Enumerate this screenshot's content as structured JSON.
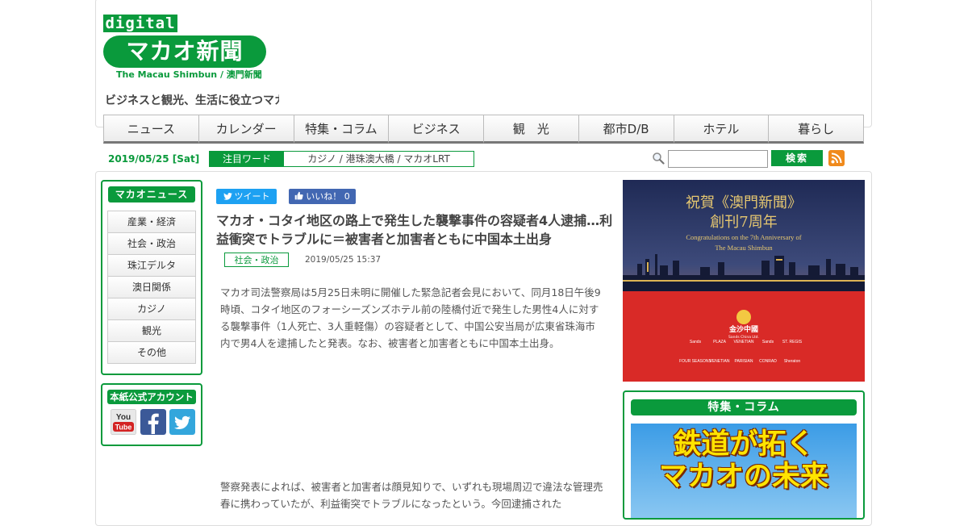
{
  "header": {
    "logo_digital": "digital",
    "logo_main": "マカオ新聞",
    "logo_sub": "The Macau Shimbun / 澳門新聞",
    "tagline": "ビジネスと観光、生活に役立つマカ"
  },
  "nav": [
    "ニュース",
    "カレンダー",
    "特集・コラム",
    "ビジネス",
    "観　光",
    "都市D/B",
    "ホテル",
    "暮らし"
  ],
  "date": "2019/05/25 [Sat]",
  "keywords": {
    "label": "注目ワード",
    "text": "カジノ / 港珠澳大橋 / マカオLRT"
  },
  "search": {
    "button_label": "検索",
    "placeholder": ""
  },
  "sidebar": {
    "heading": "マカオニュース",
    "items": [
      "産業・経済",
      "社会・政治",
      "珠江デルタ",
      "澳日関係",
      "カジノ",
      "観光",
      "その他"
    ]
  },
  "accounts": {
    "heading": "本紙公式アカウント",
    "youtube_you": "You",
    "youtube_tube": "Tube"
  },
  "share": {
    "tweet_label": "ツイート",
    "like_label": "いいね！ 0"
  },
  "article": {
    "title": "マカオ・コタイ地区の路上で発生した襲撃事件の容疑者4人逮捕…利益衝突でトラブルに＝被害者と加害者ともに中国本土出身",
    "category": "社会・政治",
    "date": "2019/05/25 15:37",
    "paragraph1": "マカオ司法警察局は5月25日未明に開催した緊急記者会見において、同月18日午後9時頃、コタイ地区のフォーシーズンズホテル前の陸橋付近で発生した男性4人に対する襲撃事件（1人死亡、3人重軽傷）の容疑者として、中国公安当局が広東省珠海市内で男4人を逮捕したと発表。なお、被害者と加害者ともに中国本土出身。",
    "paragraph2": "警察発表によれば、被害者と加害者は顔見知りで、いずれも現場周辺で違法な管理売春に携わっていたが、利益衝突でトラブルになったという。今回逮捕された"
  },
  "ad": {
    "line1": "祝賀《澳門新聞》",
    "line2": "創刊7周年",
    "line3": "Congratulations on the 7th Anniversary of",
    "line4": "The Macau Shimbun",
    "brand": "金沙中國",
    "brand_sub": "Sands China Ltd.",
    "logos": [
      "Sands",
      "PLAZA",
      "VENETIAN",
      "Sands",
      "ST. REGIS",
      "FOUR SEASONS",
      "VENETIAN",
      "PARISIAN",
      "CONRAD",
      "Sheraton"
    ]
  },
  "feature": {
    "heading": "特集・コラム",
    "line1": "鉄道が拓く",
    "line2": "マカオの未来"
  },
  "colors": {
    "brand_green": "#0a9a3c",
    "ad_red": "#d92a27",
    "ad_navy": "#1f2a55"
  }
}
